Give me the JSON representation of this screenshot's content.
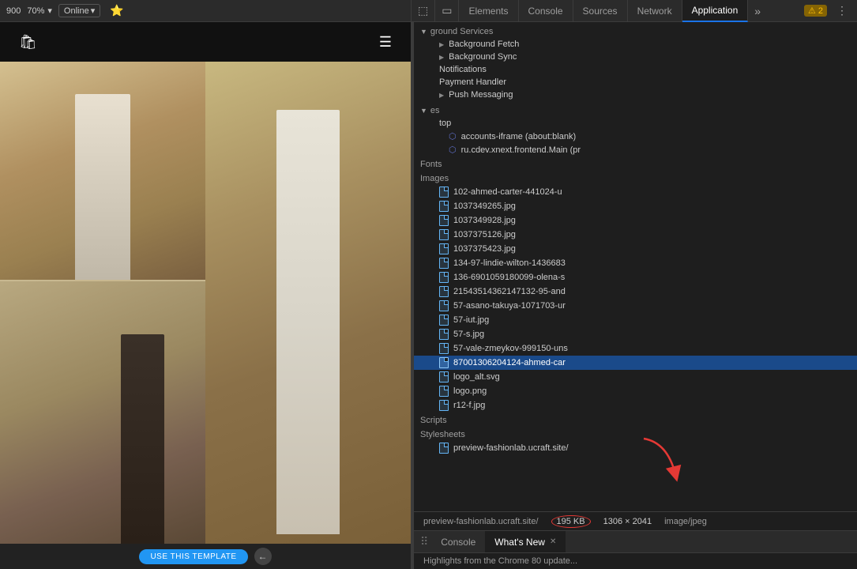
{
  "toolbar": {
    "screen_size": "900",
    "zoom": "70%",
    "zoom_arrow": "▾",
    "online": "Online",
    "online_arrow": "▾",
    "bookmark_icon": "🔖"
  },
  "devtools_header": {
    "icons": {
      "cursor": "⬚",
      "device": "▭",
      "more": "⋮"
    },
    "tabs": [
      {
        "id": "elements",
        "label": "Elements",
        "active": false
      },
      {
        "id": "console",
        "label": "Console",
        "active": false
      },
      {
        "id": "sources",
        "label": "Sources",
        "active": false
      },
      {
        "id": "network",
        "label": "Network",
        "active": false
      },
      {
        "id": "application",
        "label": "Application",
        "active": true
      }
    ],
    "more_tabs": "»",
    "warning_count": "2",
    "warning_icon": "⚠"
  },
  "app_panel": {
    "sections": {
      "background_services": {
        "label": "Background Services",
        "items": [
          {
            "id": "bg-fetch",
            "label": "Background Fetch",
            "indent": 1
          },
          {
            "id": "bg-sync",
            "label": "Background Sync",
            "indent": 1
          },
          {
            "id": "notifications",
            "label": "Notifications",
            "indent": 1
          },
          {
            "id": "payment-handler",
            "label": "Payment Handler",
            "indent": 1
          },
          {
            "id": "push-messaging",
            "label": "Push Messaging",
            "indent": 1,
            "arrow": "▶"
          }
        ]
      },
      "frames": {
        "label": "Frames",
        "items": [
          {
            "id": "top",
            "label": "top",
            "indent": 1
          },
          {
            "id": "accounts-iframe",
            "label": "accounts-iframe (about:blank)",
            "indent": 2,
            "icon": "frame"
          },
          {
            "id": "ru-cdev",
            "label": "ru.cdev.xnext.frontend.Main (pr",
            "indent": 2,
            "icon": "frame"
          }
        ]
      },
      "fonts": {
        "label": "Fonts"
      },
      "images": {
        "label": "Images",
        "items": [
          {
            "id": "img1",
            "label": "102-ahmed-carter-441024-u",
            "icon": "file"
          },
          {
            "id": "img2",
            "label": "1037349265.jpg",
            "icon": "file"
          },
          {
            "id": "img3",
            "label": "1037349928.jpg",
            "icon": "file"
          },
          {
            "id": "img4",
            "label": "1037375126.jpg",
            "icon": "file"
          },
          {
            "id": "img5",
            "label": "1037375423.jpg",
            "icon": "file"
          },
          {
            "id": "img6",
            "label": "134-97-lindie-wilton-1436683",
            "icon": "file"
          },
          {
            "id": "img7",
            "label": "136-6901059180099-olena-s",
            "icon": "file"
          },
          {
            "id": "img8",
            "label": "21543514362147132-95-and",
            "icon": "file"
          },
          {
            "id": "img9",
            "label": "57-asano-takuya-1071703-ur",
            "icon": "file"
          },
          {
            "id": "img10",
            "label": "57-iut.jpg",
            "icon": "file"
          },
          {
            "id": "img11",
            "label": "57-s.jpg",
            "icon": "file"
          },
          {
            "id": "img12",
            "label": "57-vale-zmeykov-999150-uns",
            "icon": "file"
          },
          {
            "id": "img13",
            "label": "87001306204124-ahmed-car",
            "icon": "file",
            "selected": true
          },
          {
            "id": "img14",
            "label": "logo_alt.svg",
            "icon": "file"
          },
          {
            "id": "img15",
            "label": "logo.png",
            "icon": "file"
          },
          {
            "id": "img16",
            "label": "r12-f.jpg",
            "icon": "file"
          }
        ]
      },
      "scripts": {
        "label": "Scripts"
      },
      "stylesheets": {
        "label": "Stylesheets",
        "items": [
          {
            "id": "preview-fashion",
            "label": "preview-fashionlab.ucraft.site/",
            "icon": "file"
          }
        ]
      }
    }
  },
  "status_bar": {
    "file_path": "preview-fashionlab.ucraft.site/",
    "size": "195 KB",
    "dimensions": "1306 × 2041",
    "mime_type": "image/jpeg",
    "arrow_annotation": "↓"
  },
  "console_tabs": {
    "drag_icon": "⠿",
    "tabs": [
      {
        "id": "console",
        "label": "Console",
        "active": false,
        "closeable": false
      },
      {
        "id": "whats-new",
        "label": "What's New",
        "active": true,
        "closeable": true
      }
    ],
    "bottom_text": "Highlights from the Chrome 80 update..."
  },
  "preview": {
    "use_template_btn": "USE THIS TEMPLATE",
    "back_icon": "←"
  }
}
